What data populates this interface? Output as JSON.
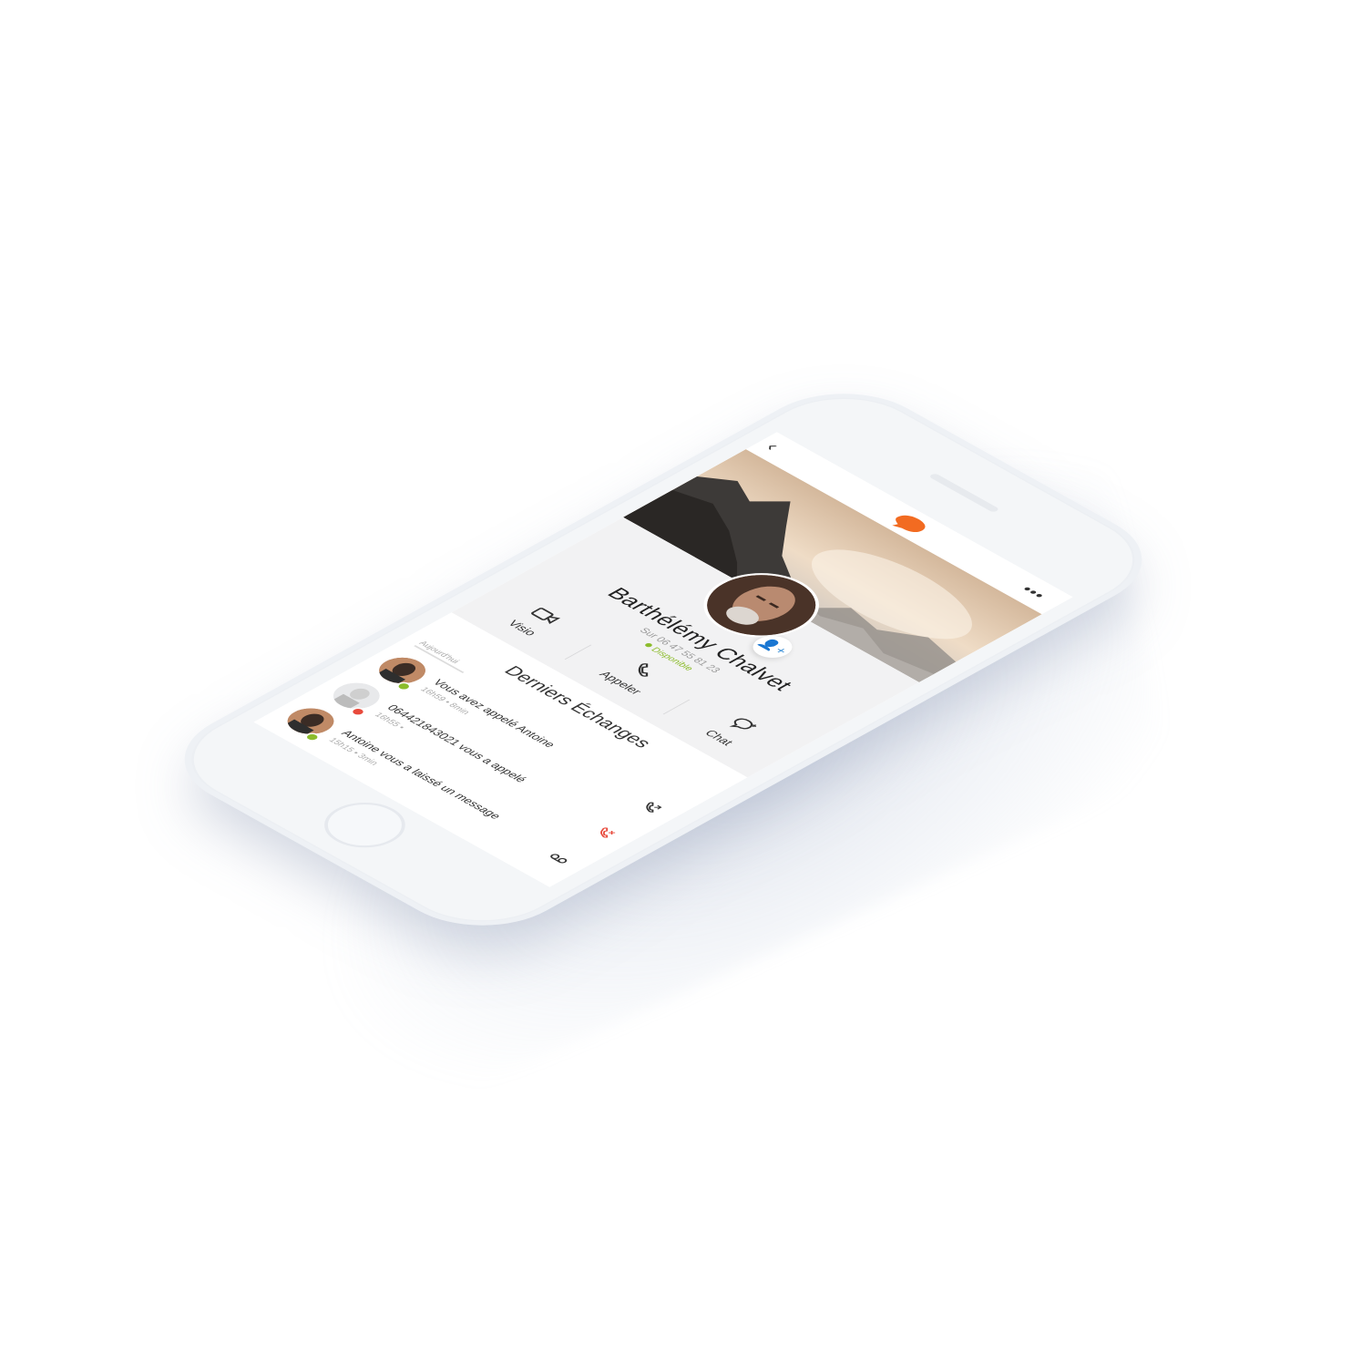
{
  "profile": {
    "name": "Barthélémy Chalvet",
    "number": "Sur 06 47 55 81 23",
    "presence": "Disponible"
  },
  "actions": [
    {
      "label": "Visio",
      "icon": "video-camera-icon"
    },
    {
      "label": "Appeler",
      "icon": "phone-icon"
    },
    {
      "label": "Chat",
      "icon": "chat-bubble-icon"
    }
  ],
  "history": {
    "title": "Derniers Échanges",
    "section": "Aujourd'hui",
    "entries": [
      {
        "text": "Vous avez appelé Antoine",
        "meta": "16h59  •  8min",
        "icon": "outgoing-call-icon",
        "status": "available"
      },
      {
        "text": "0644218430​21 vous a appelé",
        "meta": "16h55  •",
        "icon": "missed-call-icon",
        "status": "busy"
      },
      {
        "text": "Antoine vous a laissé un message",
        "meta": "15h15  •  3min",
        "icon": "voicemail-icon",
        "status": "available"
      }
    ]
  },
  "colors": {
    "brand": "#f26b21",
    "presence": "#8cbc2c",
    "busy": "#e84a3c",
    "add_contact": "#3a8fd6"
  }
}
